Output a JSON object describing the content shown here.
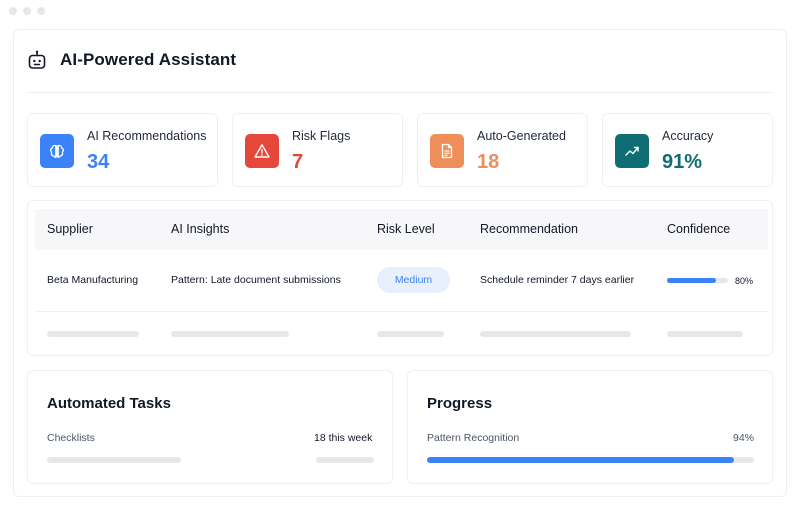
{
  "header": {
    "title": "AI-Powered Assistant",
    "icon": "robot-icon"
  },
  "stats": [
    {
      "label": "AI Recommendations",
      "value": "34",
      "icon": "brain-icon",
      "color": "#3b82f6"
    },
    {
      "label": "Risk Flags",
      "value": "7",
      "icon": "warning-icon",
      "color": "#e5483a"
    },
    {
      "label": "Auto-Generated",
      "value": "18",
      "icon": "document-icon",
      "color": "#ee8f5a"
    },
    {
      "label": "Accuracy",
      "value": "91%",
      "icon": "trend-up-icon",
      "color": "#0f6e73"
    }
  ],
  "table": {
    "headers": [
      "Supplier",
      "AI Insights",
      "Risk Level",
      "Recommendation",
      "Confidence"
    ],
    "rows": [
      {
        "supplier": "Beta Manufacturing",
        "insight": "Pattern: Late document submissions",
        "risk": "Medium",
        "recommendation": "Schedule reminder 7 days earlier",
        "confidence": "80%",
        "confidence_value": 0.8
      }
    ]
  },
  "automated": {
    "title": "Automated Tasks",
    "item_label": "Checklists",
    "item_value": "18 this week"
  },
  "progress": {
    "title": "Progress",
    "item_label": "Pattern Recognition",
    "item_value": "94%",
    "fill_value": 0.94
  },
  "colors": {
    "accent": "#3b82f6",
    "pill_bg": "#e8f0fd",
    "skeleton": "#e5e7eb"
  }
}
